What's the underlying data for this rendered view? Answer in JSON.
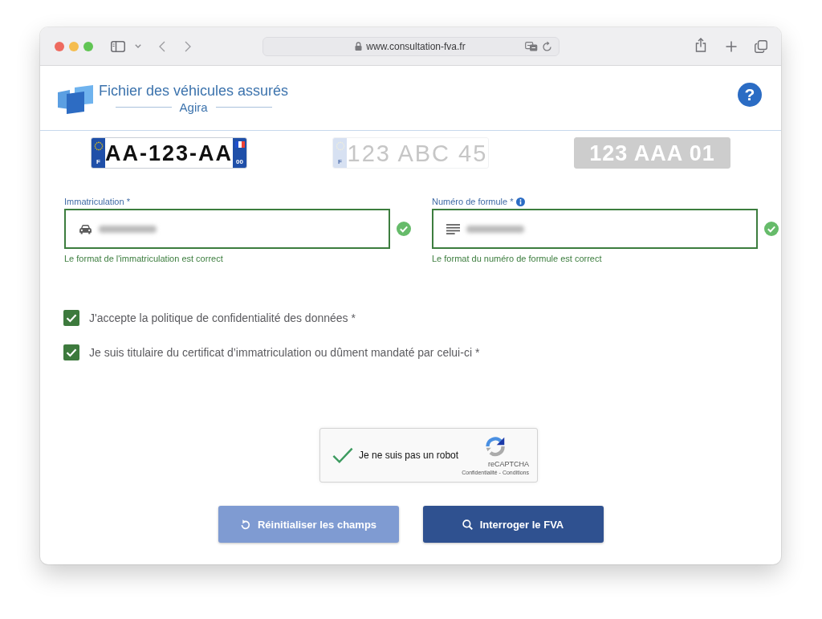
{
  "browser": {
    "url": "www.consultation-fva.fr"
  },
  "header": {
    "title": "Fichier des véhicules assurés",
    "subtitle": "Agira",
    "help": "?"
  },
  "plates": [
    {
      "kind": "current",
      "country": "F",
      "text": "AA-123-AA",
      "region": "00",
      "selected": true
    },
    {
      "kind": "fni",
      "country": "F",
      "text": "123 ABC 45",
      "selected": false
    },
    {
      "kind": "old",
      "text": "123 AAA 01",
      "selected": false
    }
  ],
  "fields": [
    {
      "kind": "plate",
      "label": "Immatriculation *",
      "info": false,
      "valid": true,
      "message": "Le format de l'immatriculation est correct"
    },
    {
      "kind": "formula",
      "label": "Numéro de formule *",
      "info": true,
      "valid": true,
      "message": "Le format du numéro de formule est correct"
    }
  ],
  "consents": [
    {
      "label": "J'accepte la politique de confidentialité des données *",
      "checked": true
    },
    {
      "label": "Je suis titulaire du certificat d’immatriculation ou dûment mandaté par celui-ci *",
      "checked": true
    }
  ],
  "captcha": {
    "label": "Je ne suis pas un robot",
    "checked": true,
    "brand": "reCAPTCHA",
    "links": [
      "Confidentialité",
      "Conditions"
    ],
    "separator": "-"
  },
  "buttons": [
    {
      "kind": "reset",
      "label": "Réinitialiser les champs",
      "disabled": true
    },
    {
      "kind": "search",
      "label": "Interroger le FVA",
      "disabled": false
    }
  ]
}
